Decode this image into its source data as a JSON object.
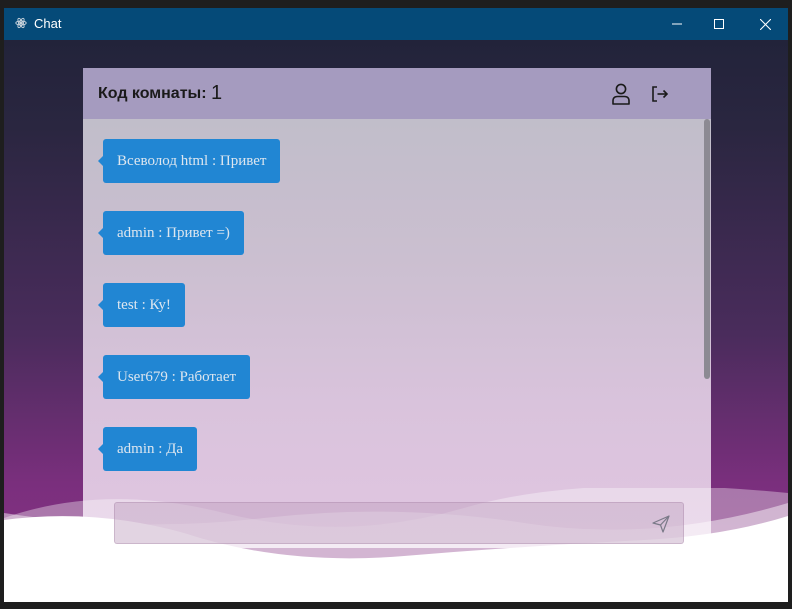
{
  "window": {
    "title": "Chat"
  },
  "header": {
    "room_label": "Код комнаты:",
    "room_code": "1"
  },
  "messages": [
    {
      "text": "Всеволод html : Привет"
    },
    {
      "text": "admin : Привет =)"
    },
    {
      "text": "test : Ку!"
    },
    {
      "text": "User679 : Работает"
    },
    {
      "text": "admin : Да"
    }
  ],
  "input": {
    "placeholder": "",
    "value": ""
  },
  "icons": {
    "app": "electron-icon",
    "profile": "user-icon",
    "logout": "logout-icon",
    "send": "send-icon"
  },
  "colors": {
    "titlebar": "#054a78",
    "header": "#a59bbf",
    "bubble": "#2186d3",
    "bubble_text": "#dde6ef"
  }
}
